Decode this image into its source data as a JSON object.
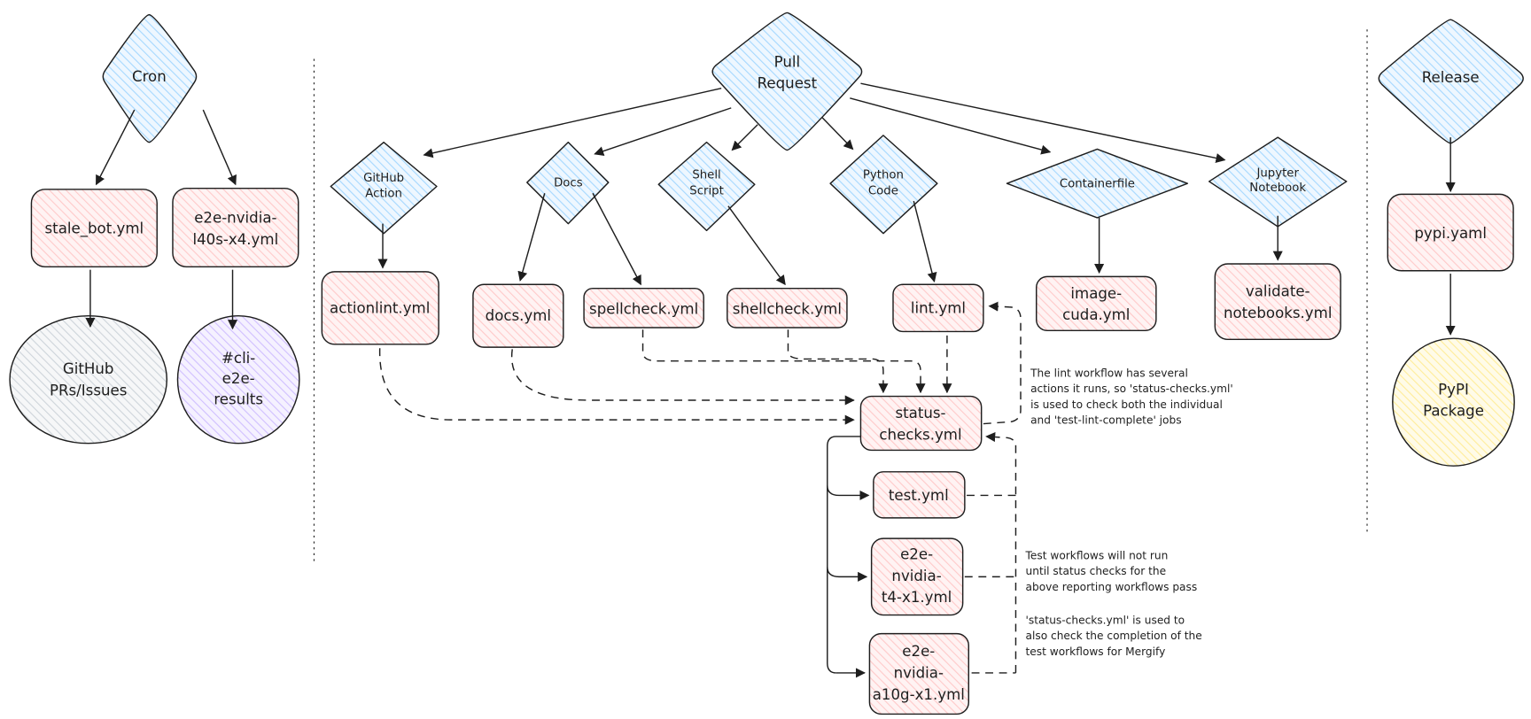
{
  "colors": {
    "trigger_fill": "#a5d8ff",
    "workflow_fill": "#ffc9c9",
    "github_fill": "#ced4da",
    "slack_fill": "#d0bfff",
    "pypi_fill": "#ffec99",
    "stroke": "#1e1e1e"
  },
  "triggers": {
    "cron": "Cron",
    "pull_request": [
      "Pull",
      "Request"
    ],
    "release": "Release",
    "github_action": [
      "GitHub",
      "Action"
    ],
    "docs": "Docs",
    "shell_script": [
      "Shell",
      "Script"
    ],
    "python_code": [
      "Python",
      "Code"
    ],
    "containerfile": "Containerfile",
    "jupyter_notebook": [
      "Jupyter",
      "Notebook"
    ]
  },
  "workflows": {
    "stale_bot": "stale_bot.yml",
    "e2e_l40s": [
      "e2e-nvidia-",
      "l40s-x4.yml"
    ],
    "actionlint": "actionlint.yml",
    "docs": "docs.yml",
    "spellcheck": "spellcheck.yml",
    "shellcheck": "shellcheck.yml",
    "lint": "lint.yml",
    "image_cuda": [
      "image-",
      "cuda.yml"
    ],
    "validate_notebooks": [
      "validate-",
      "notebooks.yml"
    ],
    "pypi": "pypi.yaml",
    "status_checks": [
      "status-",
      "checks.yml"
    ],
    "test": "test.yml",
    "e2e_t4": [
      "e2e-",
      "nvidia-",
      "t4-x1.yml"
    ],
    "e2e_a10g": [
      "e2e-",
      "nvidia-",
      "a10g-x1.yml"
    ]
  },
  "outputs": {
    "github": [
      "GitHub",
      "PRs/Issues"
    ],
    "slack": [
      "#cli-",
      "e2e-",
      "results"
    ],
    "pypi_package": [
      "PyPI",
      "Package"
    ]
  },
  "notes": {
    "lint": [
      "The lint workflow has several",
      "actions it runs, so 'status-checks.yml'",
      "is used to check both the individual",
      "and 'test-lint-complete' jobs"
    ],
    "tests": [
      "Test workflows will not run",
      "until status checks for the",
      "above reporting workflows pass"
    ],
    "mergify": [
      "'status-checks.yml' is used to",
      "also check the completion of the",
      "test workflows for Mergify"
    ]
  }
}
